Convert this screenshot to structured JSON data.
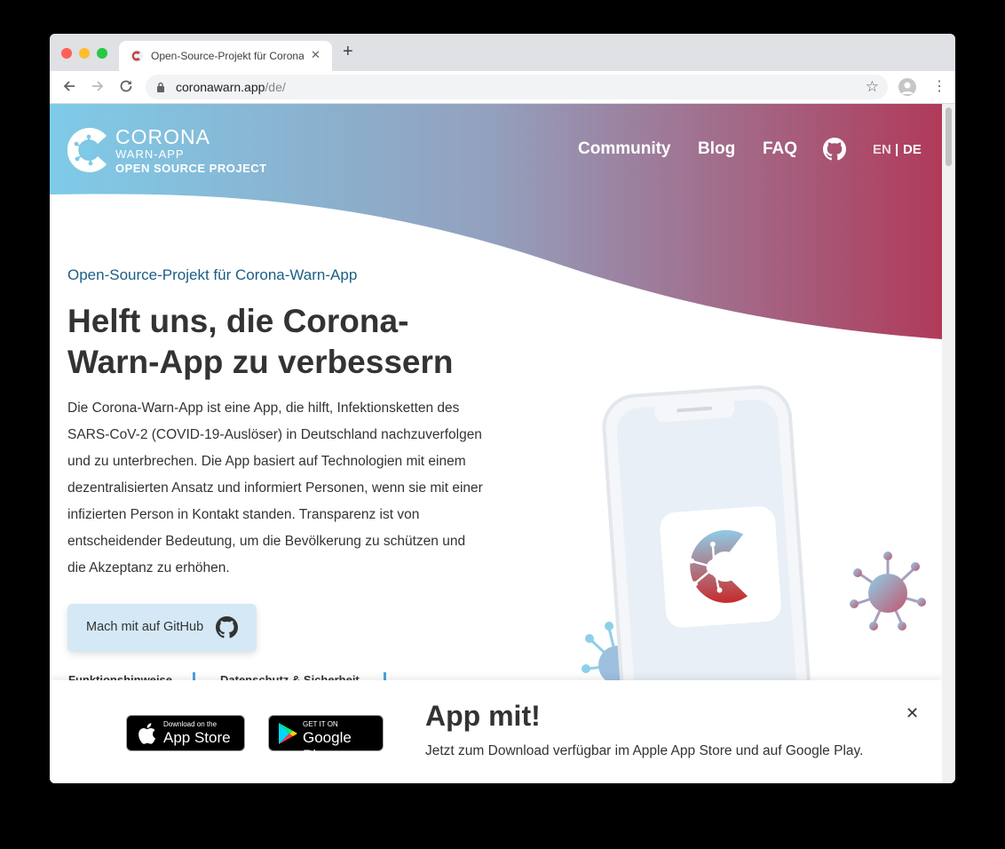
{
  "browser": {
    "tab_title": "Open-Source-Projekt für Corona-Warn-App",
    "new_tab_label": "+",
    "close_label": "✕",
    "url_host": "coronawarn.app",
    "url_path": "/de/"
  },
  "header": {
    "logo_line1": "CORONA",
    "logo_line2": "WARN-APP",
    "logo_line3": "OPEN SOURCE PROJECT",
    "nav": [
      "Community",
      "Blog",
      "FAQ"
    ],
    "lang_en": "EN",
    "lang_sep": "|",
    "lang_de": "DE"
  },
  "hero": {
    "eyebrow": "Open-Source-Projekt für Corona-Warn-App",
    "headline": "Helft uns, die Corona-Warn-App zu verbessern",
    "body": "Die Corona-Warn-App ist eine App, die hilft, Infektionsketten des SARS-CoV-2 (COVID-19-Auslöser) in Deutschland nachzuverfolgen und zu unterbrechen. Die App basiert auf Technologien mit einem dezentralisierten Ansatz und informiert Personen, wenn sie mit einer infizierten Person in Kontakt standen. Transparenz ist von entscheidender Bedeutung, um die Bevölkerung zu schützen und die Akzeptanz zu erhöhen.",
    "cta_label": "Mach mit auf GitHub"
  },
  "subnav": [
    "Funktionshinweise",
    "Datenschutz & Sicherheit"
  ],
  "banner": {
    "appstore_small": "Download on the",
    "appstore_big": "App Store",
    "googleplay_small": "GET IT ON",
    "googleplay_big": "Google Play",
    "title": "App mit!",
    "text": "Jetzt zum Download verfügbar im Apple App Store und auf Google Play.",
    "close_label": "✕"
  },
  "colors": {
    "gradient_start": "#7ecbe8",
    "gradient_end": "#b03a5a",
    "eyebrow": "#1a5e85",
    "cta_bg": "#d4e8f6"
  },
  "icons": [
    "back-arrow-icon",
    "forward-arrow-icon",
    "reload-icon",
    "lock-icon",
    "star-icon",
    "account-icon",
    "kebab-menu-icon",
    "github-icon",
    "apple-icon",
    "google-play-icon",
    "virus-icon",
    "close-icon"
  ]
}
